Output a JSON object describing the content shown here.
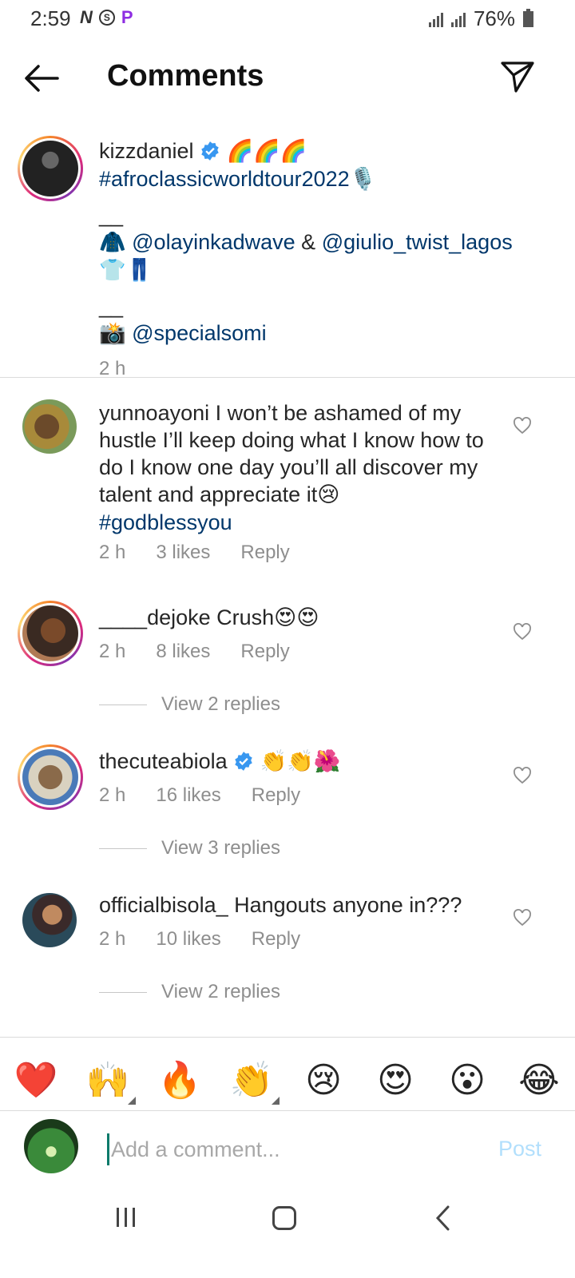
{
  "status_bar": {
    "time": "2:59",
    "battery": "76%",
    "n_icon": "N",
    "s_icon": "S",
    "p_icon": "P"
  },
  "header": {
    "title": "Comments"
  },
  "caption": {
    "username": "kizzdaniel",
    "emojis": "🌈🌈🌈",
    "hashtag": "#afroclassicworldtour2022",
    "mic_emoji": "🎙️",
    "sep1": "__",
    "coat_emoji": "🧥",
    "mention1": "@olayinkadwave",
    "and_text": " & ",
    "mention2": "@giulio_twist_lagos",
    "outfit_emojis": "👕👖",
    "sep2": "__",
    "camera_emoji": "📸",
    "mention3": "@specialsomi",
    "time": "2 h"
  },
  "comments": [
    {
      "username": "yunnoayoni",
      "text": " I won’t be ashamed of my hustle I’ll keep doing what I know how to do I know one day you’ll all discover my talent and appreciate it",
      "emoji": "😢",
      "hashtag": "#godblessyou",
      "time": "2 h",
      "likes": "3 likes",
      "reply": "Reply"
    },
    {
      "username": "____dejoke",
      "text": " Crush",
      "emoji": "😍😍",
      "time": "2 h",
      "likes": "8 likes",
      "reply": "Reply",
      "view_replies": "View 2 replies"
    },
    {
      "username": "thecuteabiola",
      "text": "",
      "emoji": "👏👏🌺",
      "time": "2 h",
      "likes": "16 likes",
      "reply": "Reply",
      "view_replies": "View 3 replies"
    },
    {
      "username": "officialbisola_",
      "text": " Hangouts anyone in???",
      "time": "2 h",
      "likes": "10 likes",
      "reply": "Reply",
      "view_replies": "View 2 replies"
    }
  ],
  "quick_emojis": [
    "❤️",
    "🙌",
    "🔥",
    "👏",
    "😢",
    "😍",
    "😮",
    "😂"
  ],
  "composer": {
    "placeholder": "Add a comment...",
    "post_label": "Post"
  },
  "colors": {
    "link": "#00376b",
    "muted": "#8e8e8e",
    "post_disabled": "#b2dffc",
    "verified": "#3897f0"
  }
}
